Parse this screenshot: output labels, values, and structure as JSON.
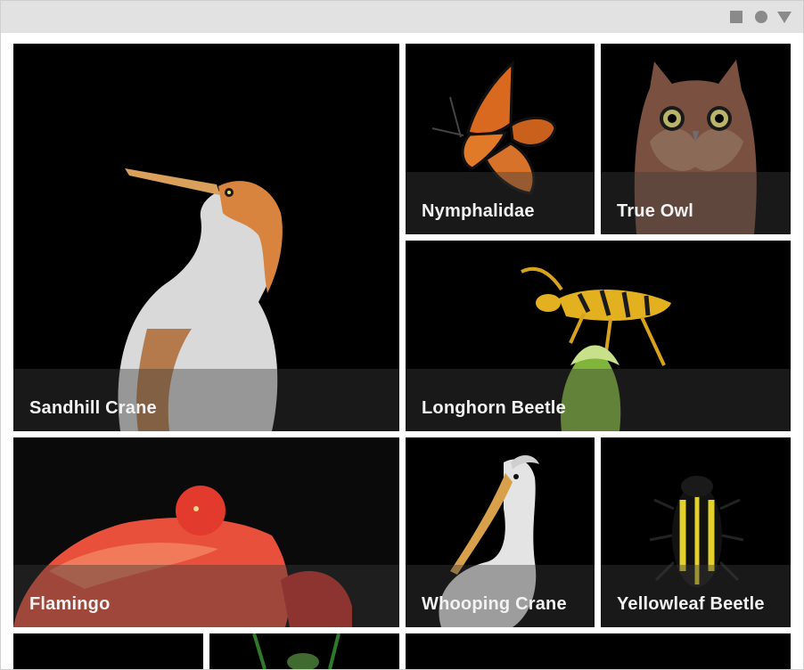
{
  "window": {
    "controls": [
      "square-icon",
      "circle-icon",
      "triangle-down-icon"
    ],
    "titlebar_color": "#e2e2e2"
  },
  "gallery": {
    "tiles": [
      {
        "label": "Sandhill Crane",
        "icon": "heron-image"
      },
      {
        "label": "Nymphalidae",
        "icon": "butterfly-image"
      },
      {
        "label": "True Owl",
        "icon": "owl-image"
      },
      {
        "label": "Longhorn Beetle",
        "icon": "beetle-image"
      },
      {
        "label": "Flamingo",
        "icon": "flamingo-image"
      },
      {
        "label": "Whooping Crane",
        "icon": "pelican-image"
      },
      {
        "label": "Yellowleaf Beetle",
        "icon": "beetle-image"
      }
    ]
  }
}
